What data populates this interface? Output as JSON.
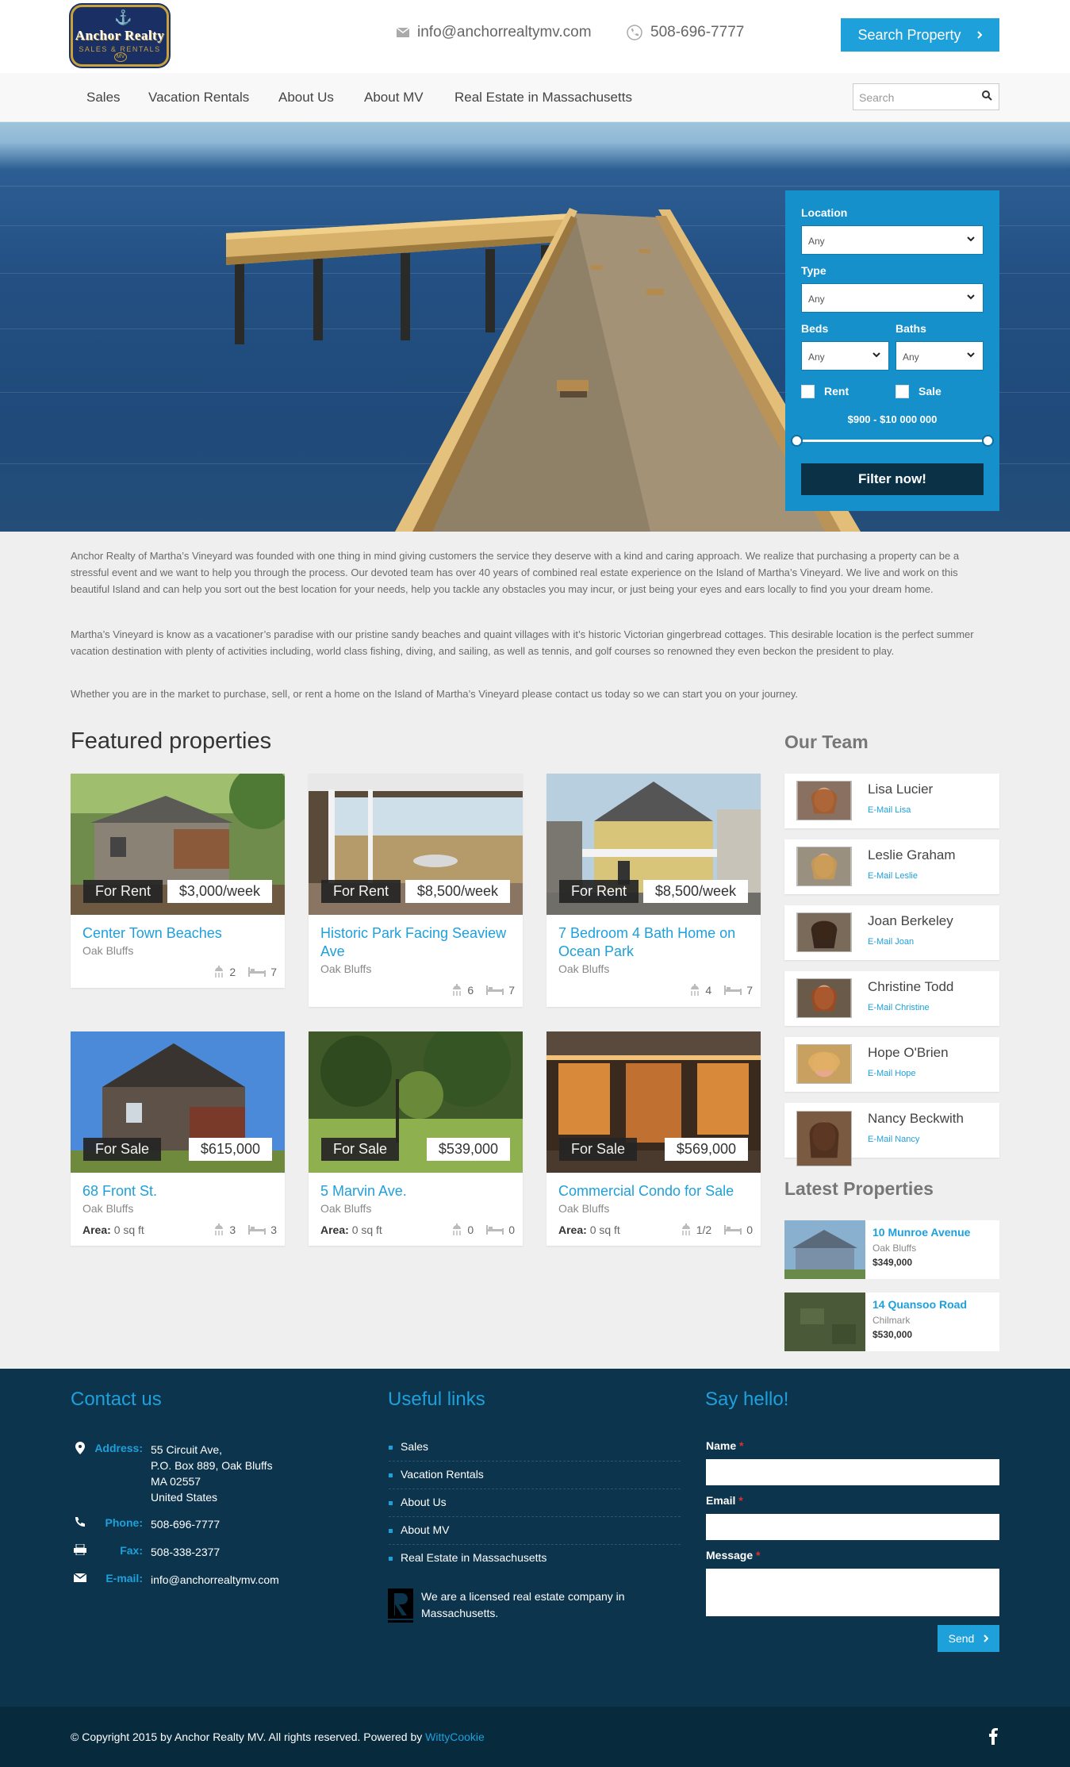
{
  "header": {
    "logo_line1": "Anchor Realty",
    "logo_line2": "SALES & RENTALS",
    "logo_mark": "MV",
    "email": "info@anchorrealtymv.com",
    "phone": "508-696-7777",
    "search_property_label": "Search Property",
    "icons": {
      "email": "envelope-icon",
      "phone": "phone-icon",
      "cta": "chevron-right-icon"
    }
  },
  "nav": {
    "items": [
      "Sales",
      "Vacation Rentals",
      "About Us",
      "About MV",
      "Real Estate in Massachusetts"
    ],
    "search_placeholder": "Search"
  },
  "filter": {
    "location_label": "Location",
    "location_value": "Any",
    "type_label": "Type",
    "type_value": "Any",
    "beds_label": "Beds",
    "beds_value": "Any",
    "baths_label": "Baths",
    "baths_value": "Any",
    "rent_label": "Rent",
    "sale_label": "Sale",
    "price_range": "$900 - $10 000 000",
    "button_label": "Filter now!"
  },
  "intro": {
    "p1": "Anchor Realty of Martha’s Vineyard was founded with one thing in mind giving customers the service they deserve with a kind and caring approach. We realize that purchasing a property can be a stressful event and we want to help you through the process. Our devoted team has over 40 years of combined real estate experience on the Island of Martha’s Vineyard. We live and work on this beautiful Island and can help you sort out the best location for your needs, help you tackle any obstacles you may incur, or just being your eyes and ears locally to find you your dream home.",
    "p2": "Martha’s Vineyard is know as a vacationer’s paradise with our pristine sandy beaches and quaint villages with it’s historic Victorian gingerbread cottages. This desirable location is the perfect summer vacation destination with plenty of activities including, world class fishing, diving, and sailing, as well as tennis, and golf courses so renowned they even beckon the president to play.",
    "p3": "Whether you are in the market to purchase, sell, or rent a home on the Island of Martha’s Vineyard please contact us today so we can start you on your journey."
  },
  "featured": {
    "title": "Featured properties",
    "area_label": "Area:",
    "properties": [
      {
        "status": "For Rent",
        "price": "$3,000/week",
        "title": "Center Town Beaches",
        "location": "Oak Bluffs",
        "baths": "2",
        "beds": "7",
        "area": ""
      },
      {
        "status": "For Rent",
        "price": "$8,500/week",
        "title": "Historic Park Facing Seaview Ave",
        "location": "Oak Bluffs",
        "baths": "6",
        "beds": "7",
        "area": ""
      },
      {
        "status": "For Rent",
        "price": "$8,500/week",
        "title": "7 Bedroom 4 Bath Home on Ocean Park",
        "location": "Oak Bluffs",
        "baths": "4",
        "beds": "7",
        "area": ""
      },
      {
        "status": "For Sale",
        "price": "$615,000",
        "title": "68 Front St.",
        "location": "Oak Bluffs",
        "baths": "3",
        "beds": "3",
        "area": "0 sq ft"
      },
      {
        "status": "For Sale",
        "price": "$539,000",
        "title": "5 Marvin Ave.",
        "location": "Oak Bluffs",
        "baths": "0",
        "beds": "0",
        "area": "0 sq ft"
      },
      {
        "status": "For Sale",
        "price": "$569,000",
        "title": "Commercial Condo for Sale",
        "location": "Oak Bluffs",
        "baths": "1/2",
        "beds": "0",
        "area": "0 sq ft"
      }
    ]
  },
  "team": {
    "title": "Our Team",
    "members": [
      {
        "name": "Lisa Lucier",
        "email_label": "E-Mail Lisa"
      },
      {
        "name": "Leslie Graham",
        "email_label": "E-Mail Leslie"
      },
      {
        "name": "Joan Berkeley",
        "email_label": "E-Mail Joan"
      },
      {
        "name": "Christine Todd",
        "email_label": "E-Mail Christine"
      },
      {
        "name": "Hope O'Brien",
        "email_label": "E-Mail Hope"
      },
      {
        "name": "Nancy Beckwith",
        "email_label": "E-Mail Nancy"
      }
    ]
  },
  "latest": {
    "title": "Latest Properties",
    "items": [
      {
        "title": "10 Munroe Avenue",
        "location": "Oak Bluffs",
        "price": "$349,000"
      },
      {
        "title": "14 Quansoo Road",
        "location": "Chilmark",
        "price": "$530,000"
      }
    ]
  },
  "footer": {
    "contact_title": "Contact us",
    "address_label": "Address:",
    "address_lines": [
      "55 Circuit Ave,",
      "P.O. Box 889, Oak Bluffs",
      "MA 02557",
      "United States"
    ],
    "phone_label": "Phone:",
    "phone": "508-696-7777",
    "fax_label": "Fax:",
    "fax": "508-338-2377",
    "email_label": "E-mail:",
    "email": "info@anchorrealtymv.com",
    "links_title": "Useful links",
    "links": [
      "Sales",
      "Vacation Rentals",
      "About Us",
      "About MV",
      "Real Estate in Massachusetts"
    ],
    "license_text": "We are a licensed real estate company in Massachusetts.",
    "hello_title": "Say hello!",
    "name_label": "Name",
    "email_field_label": "Email",
    "message_label": "Message",
    "required_mark": "*",
    "send_label": "Send",
    "copyright": "© Copyright 2015 by Anchor Realty MV. All rights reserved. Powered by",
    "powered_by": "WittyCookie",
    "social_icon": "facebook-icon"
  },
  "colors": {
    "accent": "#1ea0db",
    "footer_bg": "#0c344c",
    "filter_bg": "#1590cb",
    "filter_btn": "#0b3147"
  }
}
